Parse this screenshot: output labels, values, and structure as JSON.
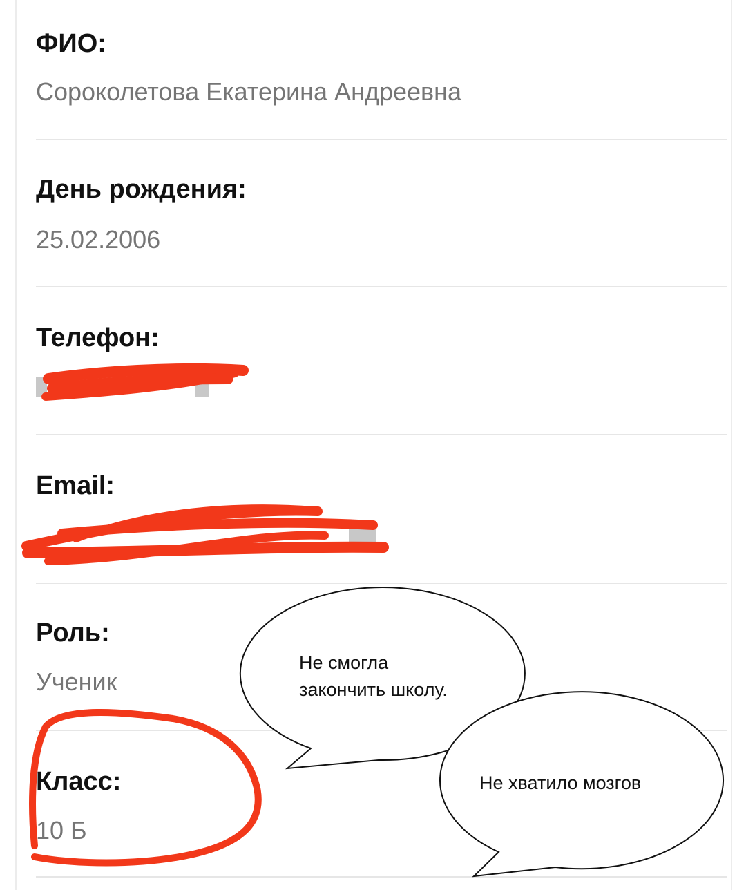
{
  "profile": {
    "full_name": {
      "label": "ФИО:",
      "value": "Сороколетова Екатерина Андреевна"
    },
    "birthday": {
      "label": "День рождения:",
      "value": "25.02.2006"
    },
    "phone": {
      "label": "Телефон:",
      "value": ""
    },
    "email": {
      "label": "Email:",
      "value": ""
    },
    "role": {
      "label": "Роль:",
      "value": "Ученик"
    },
    "class": {
      "label": "Класс:",
      "value": "10 Б"
    }
  },
  "annotations": {
    "bubble_1_line_1": "Не смогла",
    "bubble_1_line_2": "закончить  школу.",
    "bubble_2": "Не хватило мозгов",
    "scribble_color": "#f2381a"
  }
}
